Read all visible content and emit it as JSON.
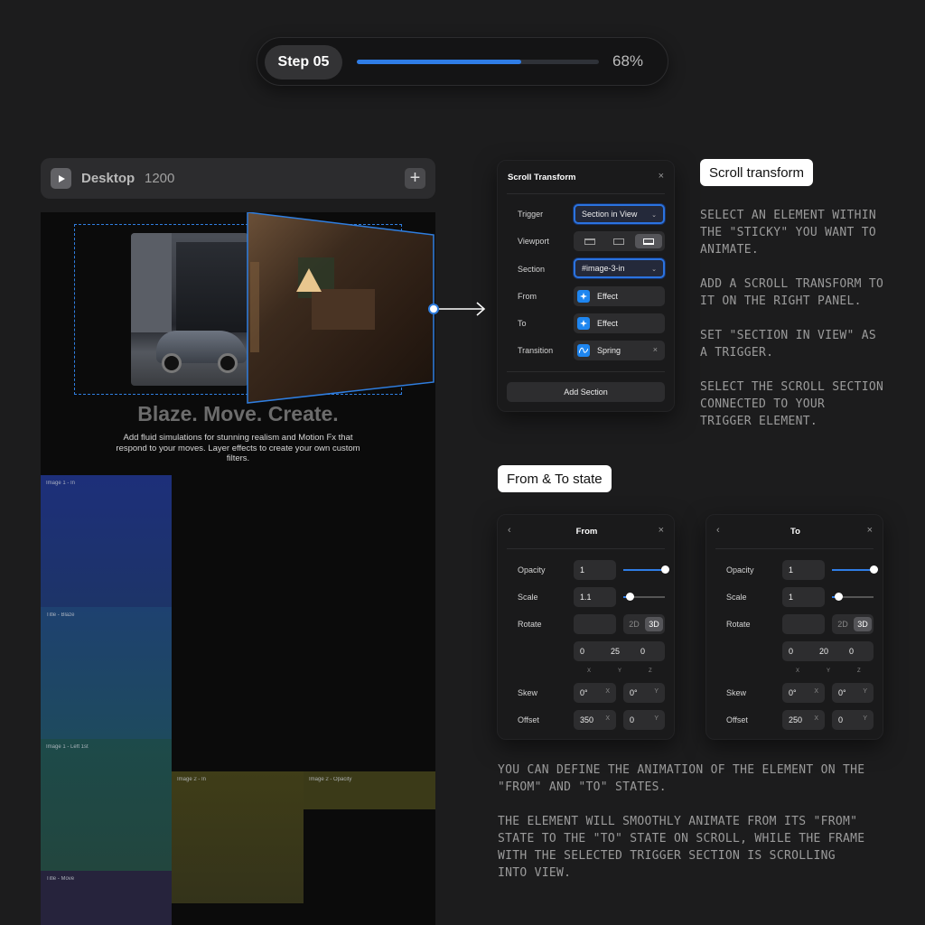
{
  "step": {
    "label": "Step 05",
    "progress_pct": 68,
    "progress_text": "68%"
  },
  "desktop": {
    "name": "Desktop",
    "width": "1200"
  },
  "hero": {
    "title": "Blaze. Move. Create.",
    "description": "Add fluid simulations for stunning realism and Motion Fx that respond to your moves. Layer effects to create your own custom filters."
  },
  "blocks": [
    {
      "label": "Image 1 - In",
      "color": "#1d2f7a"
    },
    {
      "label": "Title - Blaze",
      "color": "#1e3c6c"
    },
    {
      "label": "Image 1 - Left 1st",
      "color": "#1c4448"
    },
    {
      "label": "Title - Move",
      "color": "#24243c"
    },
    {
      "label": "Image 2 - In",
      "color": "#3b3a16"
    },
    {
      "label": "Image 2 - Opacity",
      "color": "#3a3918"
    }
  ],
  "scroll_panel": {
    "title": "Scroll Transform",
    "close": "×",
    "rows": {
      "trigger_label": "Trigger",
      "trigger_value": "Section in View",
      "viewport_label": "Viewport",
      "section_label": "Section",
      "section_value": "#image-3-in",
      "from_label": "From",
      "from_value": "Effect",
      "to_label": "To",
      "to_value": "Effect",
      "transition_label": "Transition",
      "transition_value": "Spring"
    },
    "add_section": "Add Section"
  },
  "scroll_badge": "Scroll transform",
  "scroll_instructions": [
    "SELECT AN ELEMENT WITHIN\nTHE \"STICKY\" YOU WANT TO\nANIMATE.",
    "ADD A SCROLL TRANSFORM TO\nIT ON THE RIGHT PANEL.",
    "SET \"SECTION IN VIEW\" AS\nA TRIGGER.",
    "SELECT THE SCROLL SECTION\nCONNECTED TO YOUR\nTRIGGER ELEMENT."
  ],
  "state_badge": "From & To state",
  "from_panel": {
    "title": "From",
    "back": "‹",
    "close": "×",
    "opacity_label": "Opacity",
    "opacity": "1",
    "opacity_slider": 1.0,
    "scale_label": "Scale",
    "scale": "1.1",
    "scale_slider": 0.15,
    "rotate_label": "Rotate",
    "mode_2d": "2D",
    "mode_3d": "3D",
    "rx": "0",
    "ry": "25",
    "rz": "0",
    "ax": "X",
    "ay": "Y",
    "az": "Z",
    "skew_label": "Skew",
    "skew_x": "0°",
    "skew_y": "0°",
    "offset_label": "Offset",
    "offset_x": "350",
    "offset_y": "0",
    "unit_x": "X",
    "unit_y": "Y"
  },
  "to_panel": {
    "title": "To",
    "back": "‹",
    "close": "×",
    "opacity_label": "Opacity",
    "opacity": "1",
    "opacity_slider": 1.0,
    "scale_label": "Scale",
    "scale": "1",
    "scale_slider": 0.15,
    "rotate_label": "Rotate",
    "mode_2d": "2D",
    "mode_3d": "3D",
    "rx": "0",
    "ry": "20",
    "rz": "0",
    "ax": "X",
    "ay": "Y",
    "az": "Z",
    "skew_label": "Skew",
    "skew_x": "0°",
    "skew_y": "0°",
    "offset_label": "Offset",
    "offset_x": "250",
    "offset_y": "0",
    "unit_x": "X",
    "unit_y": "Y"
  },
  "state_instructions": [
    "YOU CAN DEFINE THE ANIMATION OF THE ELEMENT ON THE\n\"FROM\" AND \"TO\" STATES.",
    "THE ELEMENT WILL SMOOTHLY ANIMATE FROM ITS \"FROM\"\nSTATE TO THE \"TO\" STATE ON SCROLL, WHILE THE FRAME\nWITH THE SELECTED TRIGGER SECTION IS SCROLLING\nINTO VIEW."
  ],
  "colors": {
    "accent": "#2f7de6",
    "bg": "#1c1c1d",
    "panel": "#1a1a1b",
    "field": "#2d2d2f"
  }
}
